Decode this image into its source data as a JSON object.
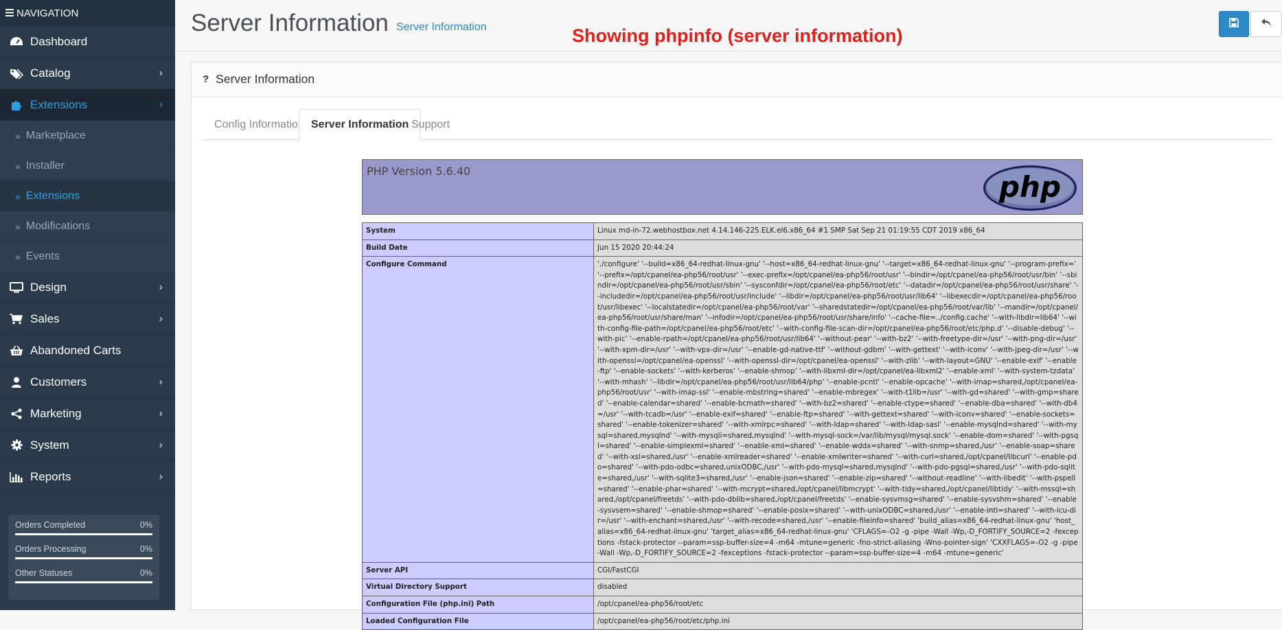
{
  "sidebar": {
    "header": "NAVIGATION",
    "menu": [
      {
        "label": "Dashboard",
        "icon": "dashboard-icon"
      },
      {
        "label": "Catalog",
        "icon": "tags-icon"
      },
      {
        "label": "Extensions",
        "icon": "puzzle-icon"
      },
      {
        "label": "Design",
        "icon": "desktop-icon"
      },
      {
        "label": "Sales",
        "icon": "cart-icon"
      },
      {
        "label": "Abandoned Carts",
        "icon": "basket-icon"
      },
      {
        "label": "Customers",
        "icon": "user-icon"
      },
      {
        "label": "Marketing",
        "icon": "share-icon"
      },
      {
        "label": "System",
        "icon": "gear-icon"
      },
      {
        "label": "Reports",
        "icon": "bar-chart-icon"
      }
    ],
    "submenu": [
      {
        "label": "Marketplace"
      },
      {
        "label": "Installer"
      },
      {
        "label": "Extensions"
      },
      {
        "label": "Modifications"
      },
      {
        "label": "Events"
      }
    ],
    "stats": [
      {
        "label": "Orders Completed",
        "value": "0%",
        "fraction": 1.0
      },
      {
        "label": "Orders Processing",
        "value": "0%",
        "fraction": 1.0
      },
      {
        "label": "Other Statuses",
        "value": "0%",
        "fraction": 1.0
      }
    ]
  },
  "header": {
    "title": "Server Information",
    "breadcrumb": "Server Information",
    "annotation": "Showing phpinfo (server information)"
  },
  "panel": {
    "heading": "Server Information",
    "tabs": [
      {
        "label": "Config Information"
      },
      {
        "label": "Server Information"
      },
      {
        "label": "Support"
      }
    ]
  },
  "phpinfo": {
    "version": "PHP Version 5.6.40",
    "logo_text": "php",
    "rows": [
      {
        "key": "System",
        "value": "Linux md-in-72.webhostbox.net 4.14.146-225.ELK.el6.x86_64 #1 SMP Sat Sep 21 01:19:55 CDT 2019 x86_64"
      },
      {
        "key": "Build Date",
        "value": "Jun 15 2020 20:44:24"
      },
      {
        "key": "Configure Command",
        "value": "'./configure' '--build=x86_64-redhat-linux-gnu' '--host=x86_64-redhat-linux-gnu' '--target=x86_64-redhat-linux-gnu' '--program-prefix=' '--prefix=/opt/cpanel/ea-php56/root/usr' '--exec-prefix=/opt/cpanel/ea-php56/root/usr' '--bindir=/opt/cpanel/ea-php56/root/usr/bin' '--sbindir=/opt/cpanel/ea-php56/root/usr/sbin' '--sysconfdir=/opt/cpanel/ea-php56/root/etc' '--datadir=/opt/cpanel/ea-php56/root/usr/share' '--includedir=/opt/cpanel/ea-php56/root/usr/include' '--libdir=/opt/cpanel/ea-php56/root/usr/lib64' '--libexecdir=/opt/cpanel/ea-php56/root/usr/libexec' '--localstatedir=/opt/cpanel/ea-php56/root/var' '--sharedstatedir=/opt/cpanel/ea-php56/root/var/lib' '--mandir=/opt/cpanel/ea-php56/root/usr/share/man' '--infodir=/opt/cpanel/ea-php56/root/usr/share/info' '--cache-file=../config.cache' '--with-libdir=lib64' '--with-config-file-path=/opt/cpanel/ea-php56/root/etc' '--with-config-file-scan-dir=/opt/cpanel/ea-php56/root/etc/php.d' '--disable-debug' '--with-pic' '--enable-rpath=/opt/cpanel/ea-php56/root/usr/lib64' '--without-pear' '--with-bz2' '--with-freetype-dir=/usr' '--with-png-dir=/usr' '--with-xpm-dir=/usr' '--with-vpx-dir=/usr' '--enable-gd-native-ttf' '--without-gdbm' '--with-gettext' '--with-iconv' '--with-jpeg-dir=/usr' '--with-openssl=/opt/cpanel/ea-openssl' '--with-openssl-dir=/opt/cpanel/ea-openssl' '--with-zlib' '--with-layout=GNU' '--enable-exif' '--enable-ftp' '--enable-sockets' '--with-kerberos' '--enable-shmop' '--with-libxml-dir=/opt/cpanel/ea-libxml2' '--enable-xml' '--with-system-tzdata' '--with-mhash' '--libdir=/opt/cpanel/ea-php56/root/usr/lib64/php' '--enable-pcntl' '--enable-opcache' '--with-imap=shared,/opt/cpanel/ea-php56/root/usr' '--with-imap-ssl' '--enable-mbstring=shared' '--enable-mbregex' '--with-t1lib=/usr' '--with-gd=shared' '--with-gmp=shared' '--enable-calendar=shared' '--enable-bcmath=shared' '--with-bz2=shared' '--enable-ctype=shared' '--enable-dba=shared' '--with-db4=/usr' '--with-tcadb=/usr' '--enable-exif=shared' '--enable-ftp=shared' '--with-gettext=shared' '--with-iconv=shared' '--enable-sockets=shared' '--enable-tokenizer=shared' '--with-xmlrpc=shared' '--with-ldap=shared' '--with-ldap-sasl' '--enable-mysqlnd=shared' '--with-mysql=shared,mysqlnd' '--with-mysqli=shared,mysqlnd' '--with-mysql-sock=/var/lib/mysql/mysql.sock' '--enable-dom=shared' '--with-pgsql=shared' '--enable-simplexml=shared' '--enable-xml=shared' '--enable-wddx=shared' '--with-snmp=shared,/usr' '--enable-soap=shared' '--with-xsl=shared,/usr' '--enable-xmlreader=shared' '--enable-xmlwriter=shared' '--with-curl=shared,/opt/cpanel/libcurl' '--enable-pdo=shared' '--with-pdo-odbc=shared,unixODBC,/usr' '--with-pdo-mysql=shared,mysqlnd' '--with-pdo-pgsql=shared,/usr' '--with-pdo-sqlite=shared,/usr' '--with-sqlite3=shared,/usr' '--enable-json=shared' '--enable-zip=shared' '--without-readline' '--with-libedit' '--with-pspell=shared' '--enable-phar=shared' '--with-mcrypt=shared,/opt/cpanel/libmcrypt' '--with-tidy=shared,/opt/cpanel/libtidy' '--with-mssql=shared,/opt/cpanel/freetds' '--with-pdo-dblib=shared,/opt/cpanel/freetds' '--enable-sysvmsg=shared' '--enable-sysvshm=shared' '--enable-sysvsem=shared' '--enable-shmop=shared' '--enable-posix=shared' '--with-unixODBC=shared,/usr' '--enable-intl=shared' '--with-icu-dir=/usr' '--with-enchant=shared,/usr' '--with-recode=shared,/usr' '--enable-fileinfo=shared' 'build_alias=x86_64-redhat-linux-gnu' 'host_alias=x86_64-redhat-linux-gnu' 'target_alias=x86_64-redhat-linux-gnu' 'CFLAGS=-O2 -g -pipe -Wall -Wp,-D_FORTIFY_SOURCE=2 -fexceptions -fstack-protector --param=ssp-buffer-size=4 -m64 -mtune=generic -fno-strict-aliasing -Wno-pointer-sign' 'CXXFLAGS=-O2 -g -pipe -Wall -Wp,-D_FORTIFY_SOURCE=2 -fexceptions -fstack-protector --param=ssp-buffer-size=4 -m64 -mtune=generic'"
      },
      {
        "key": "Server API",
        "value": "CGI/FastCGI"
      },
      {
        "key": "Virtual Directory Support",
        "value": "disabled"
      },
      {
        "key": "Configuration File (php.ini) Path",
        "value": "/opt/cpanel/ea-php56/root/etc"
      },
      {
        "key": "Loaded Configuration File",
        "value": "/opt/cpanel/ea-php56/root/etc/php.ini"
      }
    ]
  },
  "colors": {
    "sidebar_bg": "#2b3a4a",
    "accent": "#2d8ac7",
    "annotation": "#e0201b",
    "php_header": "#9999cc",
    "php_key_cell": "#ccccff",
    "php_value_cell": "#dddddd"
  }
}
